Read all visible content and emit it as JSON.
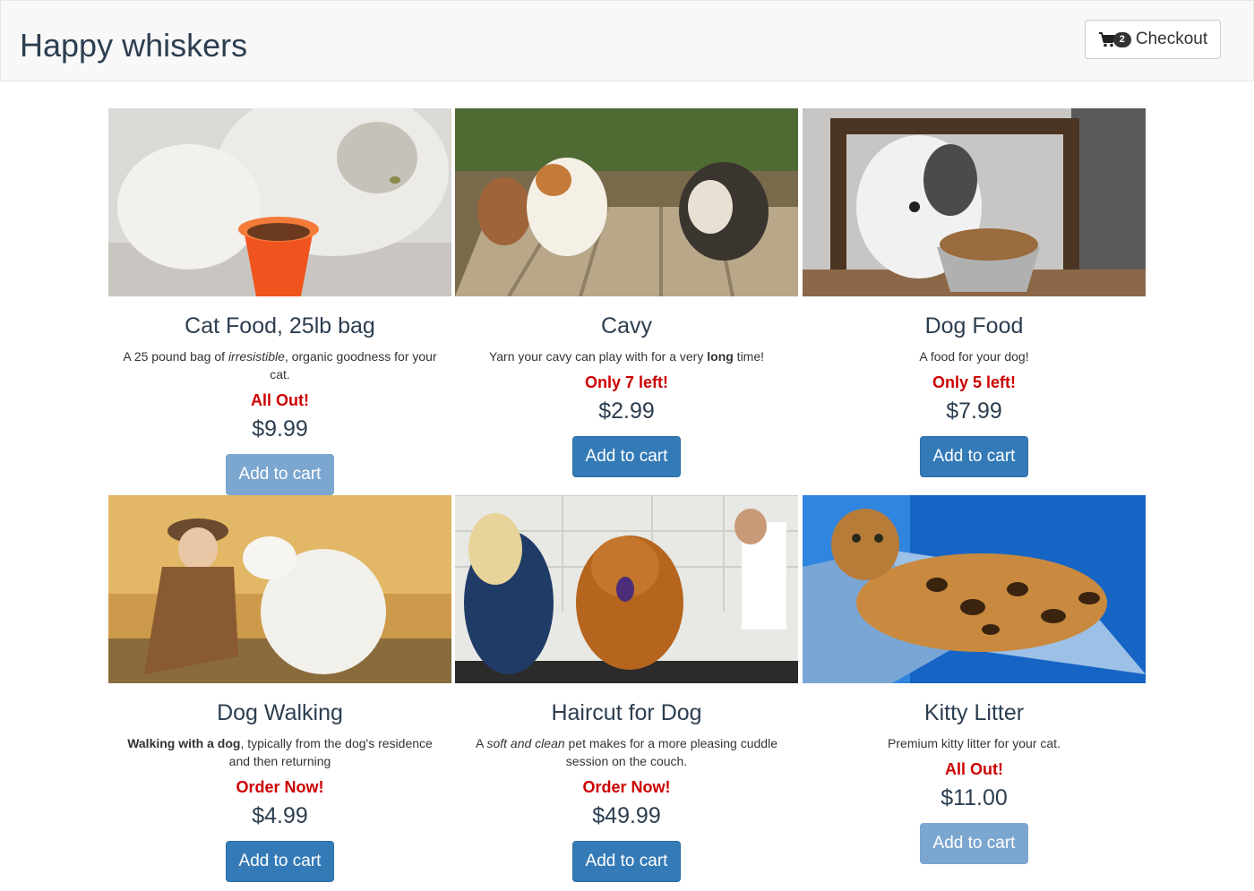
{
  "navbar": {
    "brand": "Happy whiskers",
    "checkout_label": "Checkout",
    "cart_count": "2"
  },
  "products": [
    {
      "title": "Cat Food, 25lb bag",
      "desc": [
        {
          "text": "A 25 pound bag of ",
          "style": "normal"
        },
        {
          "text": "irresistible",
          "style": "italic"
        },
        {
          "text": ", organic goodness for your cat.",
          "style": "normal"
        }
      ],
      "stock": "All Out!",
      "price": "$9.99",
      "button": "Add to cart",
      "disabled": true,
      "photo": "cat-eating-from-orange-bowl"
    },
    {
      "title": "Cavy",
      "desc": [
        {
          "text": "Yarn your cavy can play with for a very ",
          "style": "normal"
        },
        {
          "text": "long",
          "style": "bold"
        },
        {
          "text": " time!",
          "style": "normal"
        }
      ],
      "stock": "Only 7 left!",
      "price": "$2.99",
      "button": "Add to cart",
      "disabled": false,
      "photo": "guinea-pigs-on-deck"
    },
    {
      "title": "Dog Food",
      "desc": [
        {
          "text": "A food for your dog!",
          "style": "normal"
        }
      ],
      "stock": "Only 5 left!",
      "price": "$7.99",
      "button": "Add to cart",
      "disabled": false,
      "photo": "dog-at-table-with-bowl"
    },
    {
      "title": "Dog Walking",
      "desc": [
        {
          "text": "Walking with a dog",
          "style": "bold"
        },
        {
          "text": ", typically from the dog's residence and then returning",
          "style": "normal"
        }
      ],
      "stock": "Order Now!",
      "price": "$4.99",
      "button": "Add to cart",
      "disabled": false,
      "photo": "woman-with-white-dog"
    },
    {
      "title": "Haircut for Dog",
      "desc": [
        {
          "text": "A ",
          "style": "normal"
        },
        {
          "text": "soft and clean",
          "style": "italic"
        },
        {
          "text": " pet makes for a more pleasing cuddle session on the couch.",
          "style": "normal"
        }
      ],
      "stock": "Order Now!",
      "price": "$49.99",
      "button": "Add to cart",
      "disabled": false,
      "photo": "groomer-with-chow-chow"
    },
    {
      "title": "Kitty Litter",
      "desc": [
        {
          "text": "Premium kitty litter for your cat.",
          "style": "normal"
        }
      ],
      "stock": "All Out!",
      "price": "$11.00",
      "button": "Add to cart",
      "disabled": true,
      "photo": "bengal-cat-on-chair"
    }
  ]
}
